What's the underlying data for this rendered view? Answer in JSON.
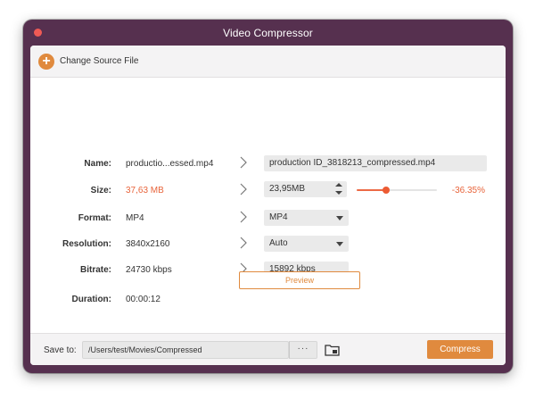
{
  "window": {
    "title": "Video Compressor"
  },
  "topbar": {
    "change_source_label": "Change Source File",
    "add_icon": "plus-icon"
  },
  "rows": {
    "name": {
      "label": "Name:",
      "source": "productio...essed.mp4",
      "target": "production ID_3818213_compressed.mp4"
    },
    "size": {
      "label": "Size:",
      "source": "37,63 MB",
      "target": "23,95MB",
      "reduction": "-36.35%",
      "slider_fraction": 0.3635,
      "source_color": "#e8643b"
    },
    "format": {
      "label": "Format:",
      "source": "MP4",
      "target": "MP4"
    },
    "resolution": {
      "label": "Resolution:",
      "source": "3840x2160",
      "target": "Auto"
    },
    "bitrate": {
      "label": "Bitrate:",
      "source": "24730 kbps",
      "target": "15892 kbps"
    },
    "duration": {
      "label": "Duration:",
      "source": "00:00:12"
    }
  },
  "preview_button": {
    "label": "Preview"
  },
  "bottombar": {
    "save_to_label": "Save to:",
    "path": "/Users/test/Movies/Compressed",
    "more_label": "···",
    "folder_icon": "open-folder-icon",
    "compress_label": "Compress"
  },
  "colors": {
    "accent": "#e08a3e",
    "warning": "#e8643b",
    "titlebar": "#56304f"
  }
}
